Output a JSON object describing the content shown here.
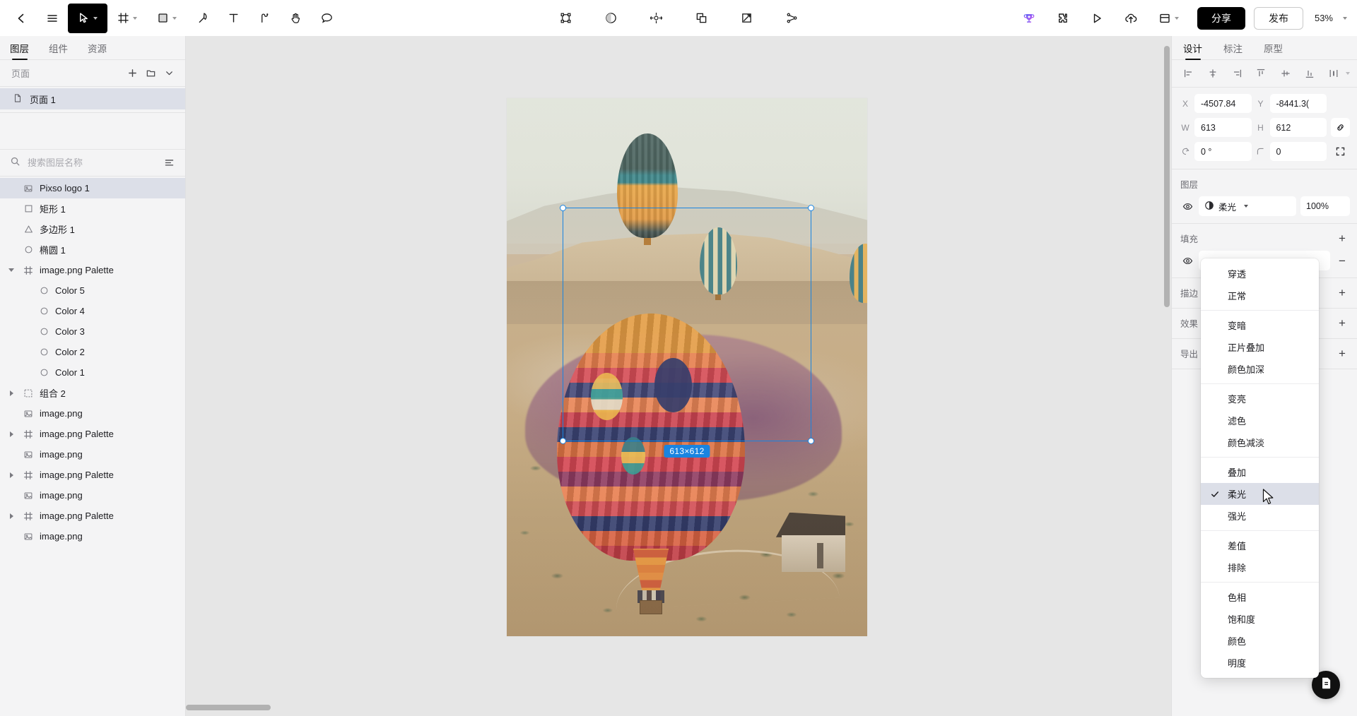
{
  "toolbar": {
    "back_label": "back-arrow",
    "menu_label": "menu",
    "tools": [
      {
        "name": "move-tool",
        "icon": "cursor-arrow-icon",
        "active": true,
        "caret": true
      },
      {
        "name": "frame-tool",
        "icon": "frame-icon",
        "active": false,
        "caret": true
      },
      {
        "name": "shape-tool",
        "icon": "square-icon",
        "active": false,
        "caret": true
      },
      {
        "name": "pen-tool",
        "icon": "pen-icon",
        "active": false,
        "caret": false
      },
      {
        "name": "text-tool",
        "icon": "text-t-icon",
        "active": false,
        "caret": false
      },
      {
        "name": "path-tool",
        "icon": "path-flag-icon",
        "active": false,
        "caret": false
      },
      {
        "name": "hand-tool",
        "icon": "hand-icon",
        "active": false,
        "caret": false
      },
      {
        "name": "comment-tool",
        "icon": "comment-bubble-icon",
        "active": false,
        "caret": false
      }
    ],
    "center_tools": [
      {
        "name": "edit-points-tool",
        "icon": "vector-points-icon"
      },
      {
        "name": "mask-tool",
        "icon": "half-circle-icon"
      },
      {
        "name": "transform-tool",
        "icon": "move-arrows-icon"
      },
      {
        "name": "boolean-tool",
        "icon": "union-shapes-icon"
      },
      {
        "name": "crop-tool",
        "icon": "crop-icon"
      },
      {
        "name": "component-tool",
        "icon": "component-nodes-icon"
      }
    ],
    "right_icons": [
      {
        "name": "rewards-icon",
        "icon": "trophy-icon"
      },
      {
        "name": "plugins-icon",
        "icon": "puzzle-icon"
      },
      {
        "name": "preview-icon",
        "icon": "play-triangle-icon"
      },
      {
        "name": "upload-icon",
        "icon": "cloud-upload-icon"
      },
      {
        "name": "layout-icon",
        "icon": "panel-layout-icon"
      }
    ],
    "share_label": "分享",
    "publish_label": "发布",
    "zoom_level": "53%"
  },
  "left_panel": {
    "tabs": [
      {
        "label": "图层",
        "active": true
      },
      {
        "label": "组件",
        "active": false
      },
      {
        "label": "资源",
        "active": false
      }
    ],
    "pages_section": {
      "title": "页面",
      "add_label": "+",
      "folder_label": "new-folder",
      "collapse_label": "collapse"
    },
    "pages": [
      {
        "label": "页面 1",
        "selected": true,
        "icon": "page-file-icon"
      }
    ],
    "search": {
      "placeholder": "搜索图层名称",
      "value": "",
      "filter_label": "filter-icon"
    },
    "layers": [
      {
        "label": "Pixso logo 1",
        "icon": "image-icon",
        "indent": 0,
        "selected": true,
        "expand": "none"
      },
      {
        "label": "矩形 1",
        "icon": "rect-icon",
        "indent": 0,
        "selected": false,
        "expand": "none"
      },
      {
        "label": "多边形 1",
        "icon": "triangle-icon",
        "indent": 0,
        "selected": false,
        "expand": "none"
      },
      {
        "label": "椭圆 1",
        "icon": "ellipse-icon",
        "indent": 0,
        "selected": false,
        "expand": "none"
      },
      {
        "label": "image.png Palette",
        "icon": "frame-icon",
        "indent": 0,
        "selected": false,
        "expand": "open"
      },
      {
        "label": "Color 5",
        "icon": "ellipse-icon",
        "indent": 1,
        "selected": false,
        "expand": "none"
      },
      {
        "label": "Color 4",
        "icon": "ellipse-icon",
        "indent": 1,
        "selected": false,
        "expand": "none"
      },
      {
        "label": "Color 3",
        "icon": "ellipse-icon",
        "indent": 1,
        "selected": false,
        "expand": "none"
      },
      {
        "label": "Color 2",
        "icon": "ellipse-icon",
        "indent": 1,
        "selected": false,
        "expand": "none"
      },
      {
        "label": "Color 1",
        "icon": "ellipse-icon",
        "indent": 1,
        "selected": false,
        "expand": "none"
      },
      {
        "label": "组合 2",
        "icon": "group-icon",
        "indent": 0,
        "selected": false,
        "expand": "closed"
      },
      {
        "label": "image.png",
        "icon": "image-icon",
        "indent": 0,
        "selected": false,
        "expand": "none"
      },
      {
        "label": "image.png Palette",
        "icon": "frame-icon",
        "indent": 0,
        "selected": false,
        "expand": "closed"
      },
      {
        "label": "image.png",
        "icon": "image-icon",
        "indent": 0,
        "selected": false,
        "expand": "none"
      },
      {
        "label": "image.png Palette",
        "icon": "frame-icon",
        "indent": 0,
        "selected": false,
        "expand": "closed"
      },
      {
        "label": "image.png",
        "icon": "image-icon",
        "indent": 0,
        "selected": false,
        "expand": "none"
      },
      {
        "label": "image.png Palette",
        "icon": "frame-icon",
        "indent": 0,
        "selected": false,
        "expand": "closed"
      },
      {
        "label": "image.png",
        "icon": "image-icon",
        "indent": 0,
        "selected": false,
        "expand": "none"
      }
    ]
  },
  "canvas": {
    "selection": {
      "size_badge": "613×612"
    },
    "photo_description": "hot air balloons over Cappadocia valley"
  },
  "right_panel": {
    "tabs": [
      {
        "label": "设计",
        "active": true
      },
      {
        "label": "标注",
        "active": false
      },
      {
        "label": "原型",
        "active": false
      }
    ],
    "align_buttons": [
      {
        "name": "align-left-icon"
      },
      {
        "name": "align-center-horizontal-icon"
      },
      {
        "name": "align-right-icon"
      },
      {
        "name": "align-top-icon"
      },
      {
        "name": "align-center-vertical-icon"
      },
      {
        "name": "align-bottom-icon"
      },
      {
        "name": "distribute-icon"
      }
    ],
    "geometry": {
      "x_label": "X",
      "x_value": "-4507.84",
      "y_label": "Y",
      "y_value": "-8441.3(",
      "w_label": "W",
      "w_value": "613",
      "h_label": "H",
      "h_value": "612",
      "rotation_label": "rotation",
      "rotation_value": "0 °",
      "radius_label": "corner-radius",
      "radius_value": "0",
      "link_label": "constrain-proportions",
      "independent_corners_label": "independent-corners"
    },
    "layer_section": {
      "title": "图层",
      "blend_mode": "柔光",
      "opacity": "100%"
    },
    "fill_section": {
      "title": "填充",
      "add": "+",
      "remove": "−"
    },
    "stroke_section": {
      "title": "描边",
      "add": "+"
    },
    "effects_section": {
      "title": "效果",
      "add": "+"
    },
    "export_section": {
      "title": "导出",
      "add": "+"
    }
  },
  "blend_dropdown": {
    "groups": [
      [
        {
          "label": "穿透",
          "checked": false
        },
        {
          "label": "正常",
          "checked": false
        }
      ],
      [
        {
          "label": "变暗",
          "checked": false
        },
        {
          "label": "正片叠加",
          "checked": false
        },
        {
          "label": "颜色加深",
          "checked": false
        }
      ],
      [
        {
          "label": "变亮",
          "checked": false
        },
        {
          "label": "滤色",
          "checked": false
        },
        {
          "label": "颜色减淡",
          "checked": false
        }
      ],
      [
        {
          "label": "叠加",
          "checked": false
        },
        {
          "label": "柔光",
          "checked": true
        },
        {
          "label": "强光",
          "checked": false
        }
      ],
      [
        {
          "label": "差值",
          "checked": false
        },
        {
          "label": "排除",
          "checked": false
        }
      ],
      [
        {
          "label": "色相",
          "checked": false
        },
        {
          "label": "饱和度",
          "checked": false
        },
        {
          "label": "颜色",
          "checked": false
        },
        {
          "label": "明度",
          "checked": false
        }
      ]
    ]
  },
  "fab": {
    "name": "notes-icon"
  },
  "colors": {
    "accent_selection": "#1a84e0",
    "panel_bg": "#f4f4f5",
    "canvas_bg": "#e6e6e6",
    "selected_row": "#dcdfe8",
    "button_black": "#000000"
  }
}
